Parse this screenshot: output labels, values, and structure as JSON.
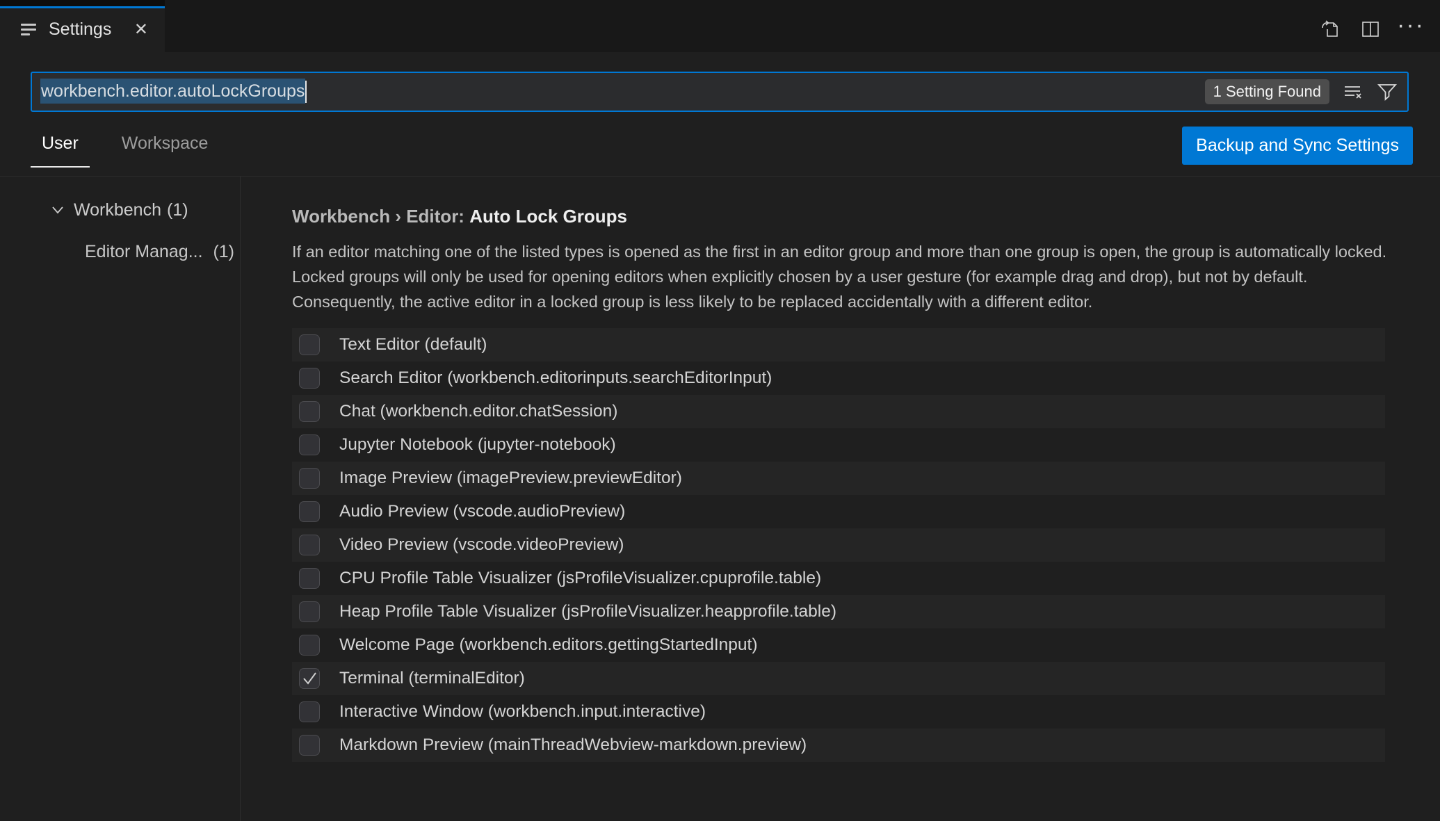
{
  "tab": {
    "title": "Settings"
  },
  "editor_actions": {
    "open_settings_json_icon": "open-settings-json",
    "split_editor_icon": "split-editor",
    "more_actions_glyph": "···"
  },
  "search": {
    "value": "workbench.editor.autoLockGroups",
    "results_badge": "1 Setting Found",
    "clear_icon": "clear-settings-search-results",
    "filter_icon": "filter-settings"
  },
  "scope_tabs": {
    "user": "User",
    "workspace": "Workspace"
  },
  "sync_button": {
    "label": "Backup and Sync Settings"
  },
  "toc": {
    "items": [
      {
        "label": "Workbench",
        "count": "(1)"
      },
      {
        "label": "Editor Manag...",
        "count": "(1)"
      }
    ]
  },
  "setting": {
    "category": "Workbench › Editor: ",
    "name": "Auto Lock Groups",
    "description": "If an editor matching one of the listed types is opened as the first in an editor group and more than one group is open, the group is automatically locked. Locked groups will only be used for opening editors when explicitly chosen by a user gesture (for example drag and drop), but not by default. Consequently, the active editor in a locked group is less likely to be replaced accidentally with a different editor.",
    "options": [
      {
        "label": "Text Editor (default)",
        "checked": false
      },
      {
        "label": "Search Editor (workbench.editorinputs.searchEditorInput)",
        "checked": false
      },
      {
        "label": "Chat (workbench.editor.chatSession)",
        "checked": false
      },
      {
        "label": "Jupyter Notebook (jupyter-notebook)",
        "checked": false
      },
      {
        "label": "Image Preview (imagePreview.previewEditor)",
        "checked": false
      },
      {
        "label": "Audio Preview (vscode.audioPreview)",
        "checked": false
      },
      {
        "label": "Video Preview (vscode.videoPreview)",
        "checked": false
      },
      {
        "label": "CPU Profile Table Visualizer (jsProfileVisualizer.cpuprofile.table)",
        "checked": false
      },
      {
        "label": "Heap Profile Table Visualizer (jsProfileVisualizer.heapprofile.table)",
        "checked": false
      },
      {
        "label": "Welcome Page (workbench.editors.gettingStartedInput)",
        "checked": false
      },
      {
        "label": "Terminal (terminalEditor)",
        "checked": true
      },
      {
        "label": "Interactive Window (workbench.input.interactive)",
        "checked": false
      },
      {
        "label": "Markdown Preview (mainThreadWebview-markdown.preview)",
        "checked": false
      }
    ]
  },
  "colors": {
    "accent_blue": "#0078d4",
    "background": "#1f1f1f",
    "tabstrip_background": "#181818",
    "selection_blue": "#2a5273",
    "badge_gray": "#4d4d4d"
  }
}
